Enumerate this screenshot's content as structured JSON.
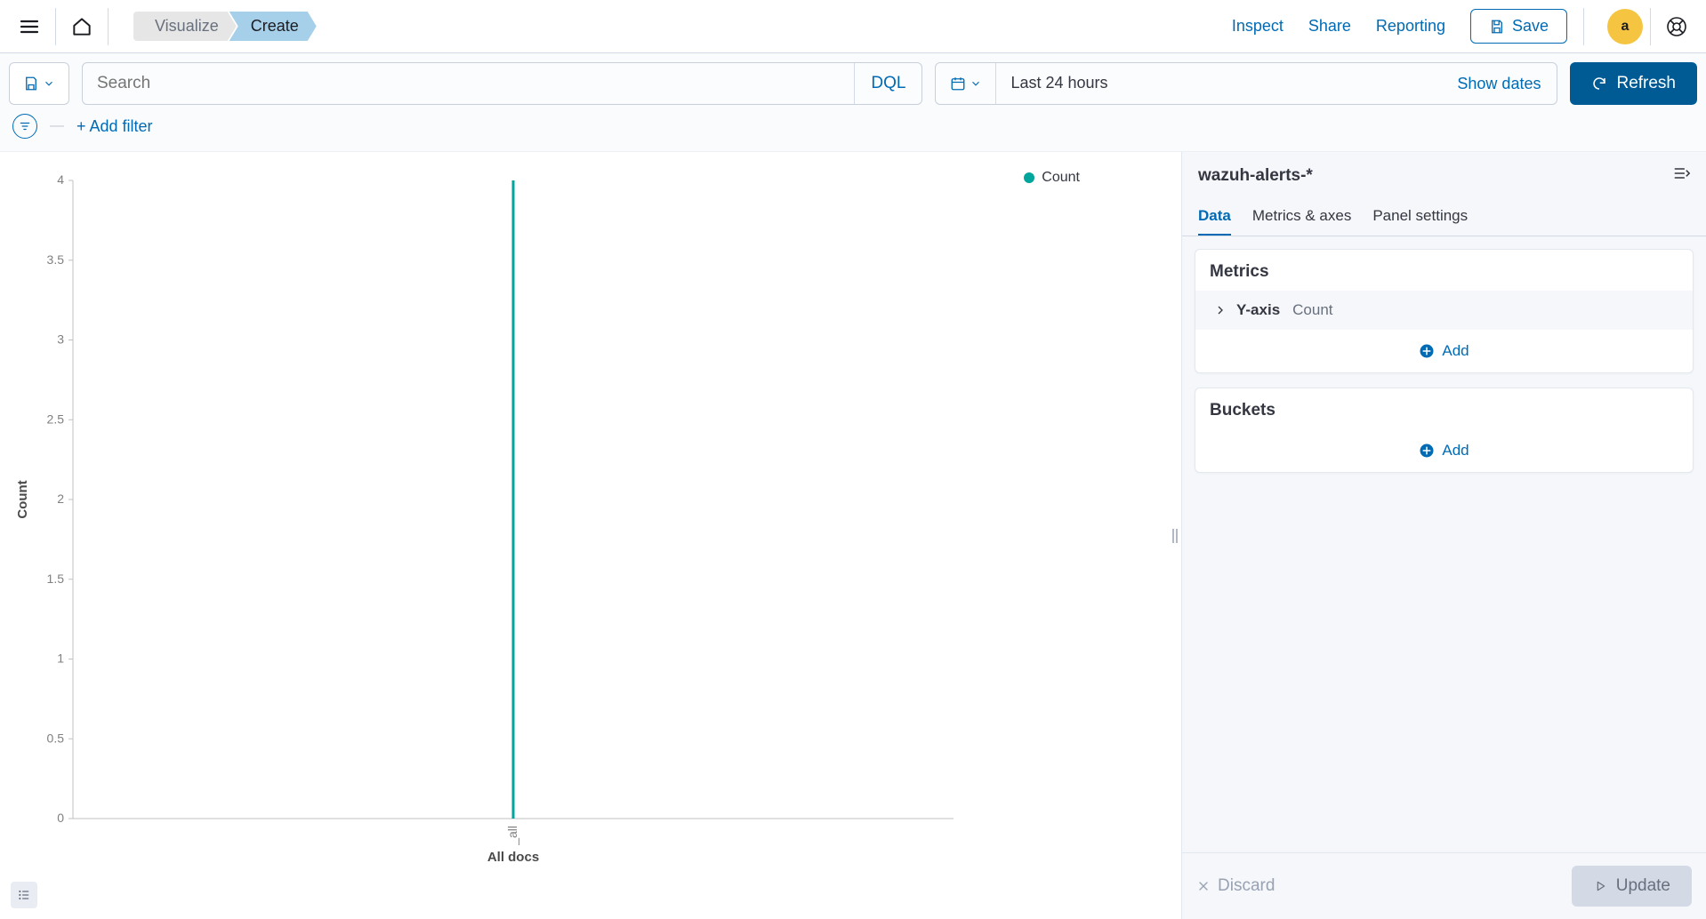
{
  "nav": {
    "breadcrumbs": [
      "Visualize",
      "Create"
    ],
    "links": {
      "inspect": "Inspect",
      "share": "Share",
      "reporting": "Reporting"
    },
    "save_label": "Save",
    "avatar_initial": "a"
  },
  "query": {
    "search_placeholder": "Search",
    "dql_label": "DQL",
    "time_range": "Last 24 hours",
    "show_dates_label": "Show dates",
    "refresh_label": "Refresh"
  },
  "filter": {
    "add_filter_label": "+ Add filter"
  },
  "legend": {
    "series_name": "Count"
  },
  "chart_data": {
    "type": "bar",
    "categories": [
      "_all"
    ],
    "values": [
      4
    ],
    "xlabel": "All docs",
    "ylabel": "Count",
    "ylim": [
      0,
      4
    ],
    "yticks": [
      0,
      0.5,
      1,
      1.5,
      2,
      2.5,
      3,
      3.5,
      4
    ],
    "series_color": "#00a69b"
  },
  "panel": {
    "index_pattern": "wazuh-alerts-*",
    "tabs": {
      "data": "Data",
      "metrics_axes": "Metrics & axes",
      "panel_settings": "Panel settings"
    },
    "metrics": {
      "title": "Metrics",
      "rows": [
        {
          "label": "Y-axis",
          "value": "Count"
        }
      ],
      "add_label": "Add"
    },
    "buckets": {
      "title": "Buckets",
      "add_label": "Add"
    },
    "footer": {
      "discard_label": "Discard",
      "update_label": "Update"
    }
  }
}
